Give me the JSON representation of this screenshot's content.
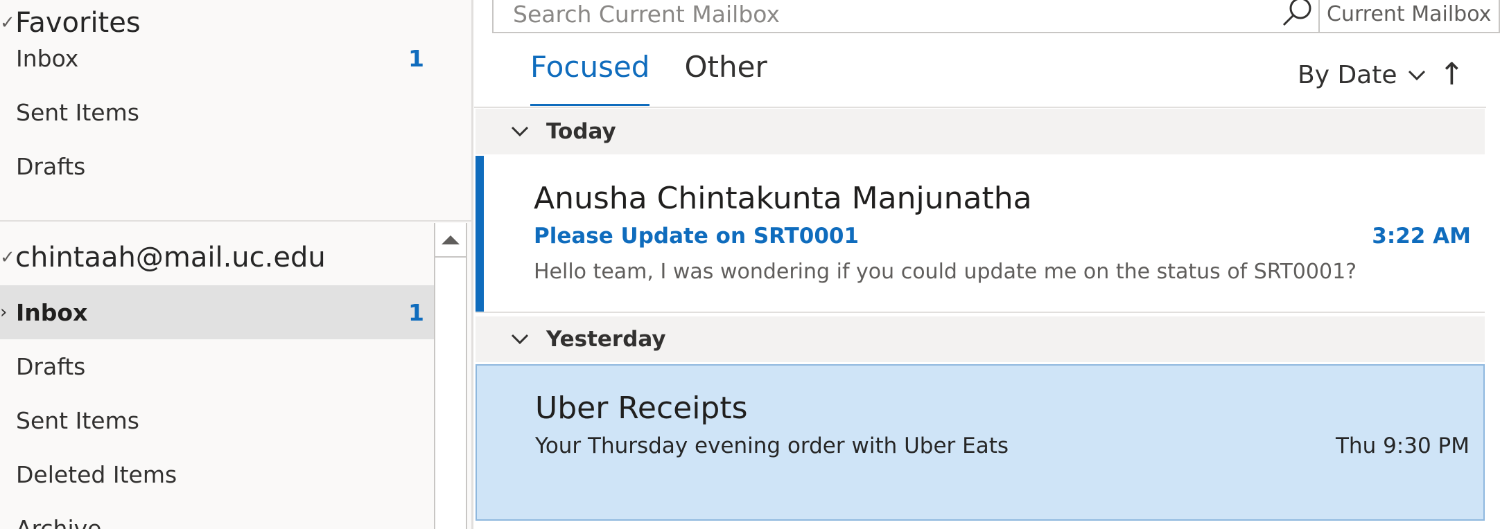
{
  "sidebar": {
    "favorites": {
      "title": "Favorites",
      "folders": [
        {
          "label": "Inbox",
          "count": "1"
        },
        {
          "label": "Sent Items",
          "count": ""
        },
        {
          "label": "Drafts",
          "count": ""
        }
      ]
    },
    "account": {
      "title": "chintaah@mail.uc.edu",
      "folders": [
        {
          "label": "Inbox",
          "count": "1",
          "selected": true
        },
        {
          "label": "Drafts",
          "count": ""
        },
        {
          "label": "Sent Items",
          "count": ""
        },
        {
          "label": "Deleted Items",
          "count": ""
        },
        {
          "label": "Archive",
          "count": ""
        }
      ]
    }
  },
  "search": {
    "placeholder": "Search Current Mailbox",
    "scope": "Current Mailbox"
  },
  "tabs": [
    {
      "label": "Focused",
      "active": true
    },
    {
      "label": "Other",
      "active": false
    }
  ],
  "sort": {
    "label": "By Date",
    "direction_glyph": "↑"
  },
  "groups": [
    {
      "label": "Today",
      "messages": [
        {
          "sender": "Anusha Chintakunta Manjunatha",
          "subject": "Please Update on SRT0001",
          "time": "3:22 AM",
          "preview": "Hello team,  I was wondering if you could update me on the status of SRT0001?",
          "unread": true
        }
      ]
    },
    {
      "label": "Yesterday",
      "messages": [
        {
          "sender": "Uber Receipts",
          "subject": "Your Thursday evening order with Uber Eats",
          "time": "Thu 9:30 PM",
          "selected": true
        }
      ]
    }
  ],
  "colors": {
    "accent": "#0f6cbd",
    "selected_message": "#cfe4f7",
    "group_header": "#f3f2f1"
  }
}
